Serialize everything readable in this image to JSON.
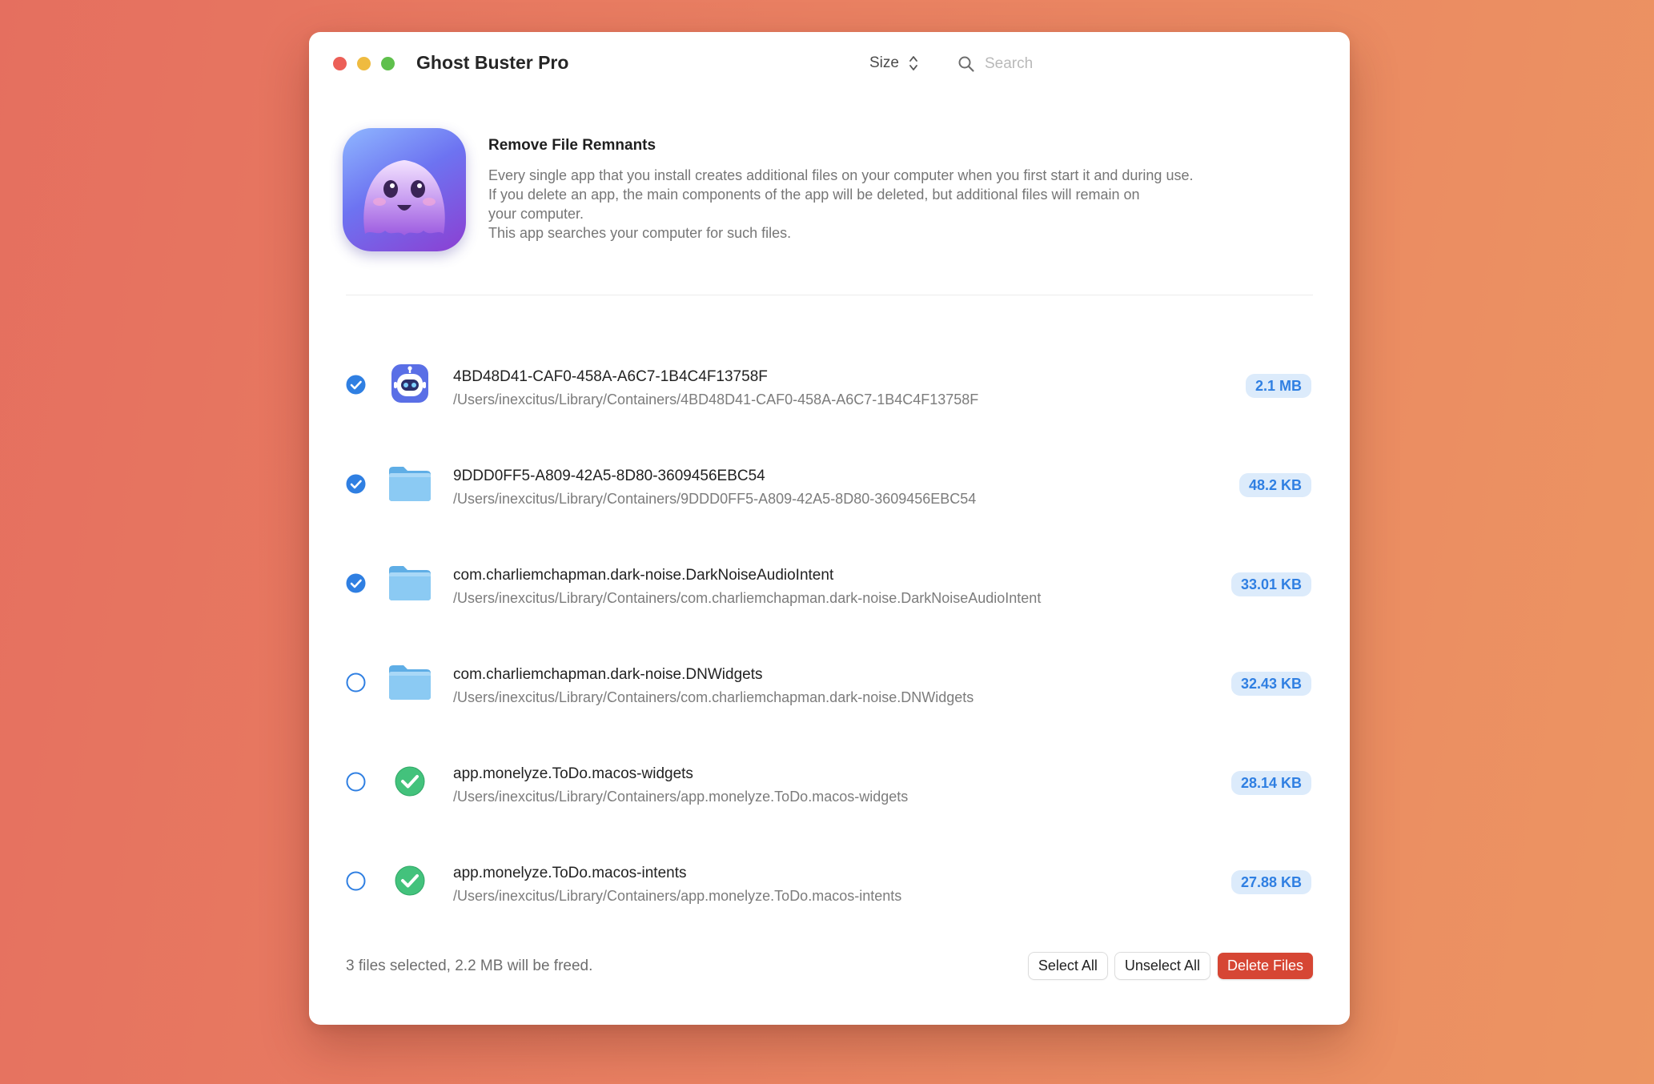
{
  "window": {
    "title": "Ghost Buster Pro",
    "sort": {
      "label": "Size"
    },
    "search": {
      "placeholder": "Search",
      "value": ""
    }
  },
  "info": {
    "title": "Remove File Remnants",
    "lines": [
      "Every single app that you install creates additional files on your computer when you first start it and during use.",
      "If you delete an app, the main components of the app will be deleted, but additional files will remain on",
      "your computer.",
      "This app searches your computer for such files."
    ]
  },
  "files": [
    {
      "name": "4BD48D41-CAF0-458A-A6C7-1B4C4F13758F",
      "path": "/Users/inexcitus/Library/Containers/4BD48D41-CAF0-458A-A6C7-1B4C4F13758F",
      "size": "2.1 MB",
      "selected": true,
      "icon": "robot-app-icon"
    },
    {
      "name": "9DDD0FF5-A809-42A5-8D80-3609456EBC54",
      "path": "/Users/inexcitus/Library/Containers/9DDD0FF5-A809-42A5-8D80-3609456EBC54",
      "size": "48.2 KB",
      "selected": true,
      "icon": "folder-icon"
    },
    {
      "name": "com.charliemchapman.dark-noise.DarkNoiseAudioIntent",
      "path": "/Users/inexcitus/Library/Containers/com.charliemchapman.dark-noise.DarkNoiseAudioIntent",
      "size": "33.01 KB",
      "selected": true,
      "icon": "folder-icon"
    },
    {
      "name": "com.charliemchapman.dark-noise.DNWidgets",
      "path": "/Users/inexcitus/Library/Containers/com.charliemchapman.dark-noise.DNWidgets",
      "size": "32.43 KB",
      "selected": false,
      "icon": "folder-icon"
    },
    {
      "name": "app.monelyze.ToDo.macos-widgets",
      "path": "/Users/inexcitus/Library/Containers/app.monelyze.ToDo.macos-widgets",
      "size": "28.14 KB",
      "selected": false,
      "icon": "green-checkmark-app-icon"
    },
    {
      "name": "app.monelyze.ToDo.macos-intents",
      "path": "/Users/inexcitus/Library/Containers/app.monelyze.ToDo.macos-intents",
      "size": "27.88 KB",
      "selected": false,
      "icon": "green-checkmark-app-icon"
    }
  ],
  "footer": {
    "status": "3 files selected, 2.2 MB will be freed.",
    "select_all": "Select All",
    "unselect_all": "Unselect All",
    "delete": "Delete Files"
  },
  "colors": {
    "accent": "#2f7fe2",
    "badge_background": "#dcebfb",
    "danger": "#d64634",
    "background_left": "#e56f5f",
    "background_right": "#ec9562"
  }
}
